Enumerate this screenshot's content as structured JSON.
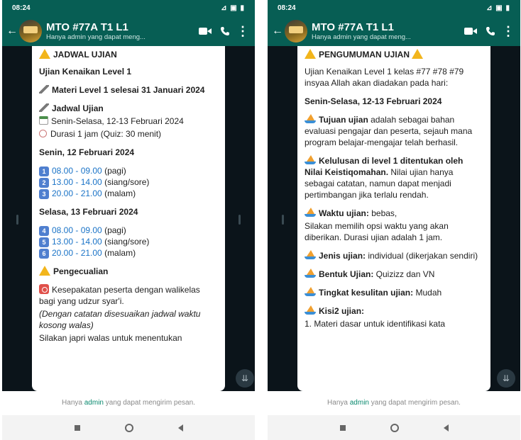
{
  "status_bar": {
    "time": "08:24",
    "icons": "⊿ ▣ ▮"
  },
  "chat_header": {
    "title": "MTO #77A T1 L1",
    "subtitle": "Hanya admin yang dapat meng...",
    "back_icon": "arrow-left-icon",
    "video_icon": "video-camera-icon",
    "call_icon": "phone-icon",
    "menu_icon": "kebab-menu-icon"
  },
  "left_message": {
    "heading": "JADWAL UJIAN",
    "exam_name": "Ujian Kenaikan Level 1",
    "materi": "Materi Level 1 selesai 31 Januari 2024",
    "jadwal_title": "Jadwal Ujian",
    "jadwal_date": "Senin-Selasa, 12-13 Februari 2024",
    "durasi": "Durasi 1 jam (Quiz: 30 menit)",
    "day1_title": "Senin, 12 Februari 2024",
    "day1_slots": [
      {
        "num": "1",
        "time": "08.00 - 09.00",
        "label": "(pagi)"
      },
      {
        "num": "2",
        "time": "13.00 - 14.00",
        "label": "(siang/sore)"
      },
      {
        "num": "3",
        "time": "20.00 - 21.00",
        "label": "(malam)"
      }
    ],
    "day2_title": "Selasa, 13 Februari 2024",
    "day2_slots": [
      {
        "num": "4",
        "time": "08.00 - 09.00",
        "label": "(pagi)"
      },
      {
        "num": "5",
        "time": "13.00 - 14.00",
        "label": "(siang/sore)"
      },
      {
        "num": "6",
        "time": "20.00 - 21.00",
        "label": "(malam)"
      }
    ],
    "exception_title": "Pengecualian",
    "exception_text": "Kesepakatan peserta dengan walikelas bagi yang udzur syar'i.",
    "exception_italic": "(Dengan catatan disesuaikan jadwal waktu kosong walas)",
    "cutoff_text": "Silakan japri walas untuk menentukan"
  },
  "right_message": {
    "heading": "PENGUMUMAN UJIAN",
    "intro": "Ujian Kenaikan Level 1 kelas #77 #78 #79 insyaa Allah akan diadakan pada hari:",
    "date": "Senin-Selasa, 12-13 Februari 2024",
    "tujuan_bold": "Tujuan ujian",
    "tujuan_text": " adalah sebagai bahan evaluasi pengajar dan peserta, sejauh mana program belajar-mengajar telah berhasil.",
    "kelulusan_bold": "Kelulusan di level 1 ditentukan oleh Nilai Keistiqomahan.",
    "kelulusan_text": " Nilai ujian hanya sebagai catatan, namun dapat menjadi pertimbangan jika terlalu rendah.",
    "waktu_bold": "Waktu ujian:",
    "waktu_text": " bebas,",
    "waktu_detail": "Silakan memilih opsi waktu yang akan diberikan. Durasi ujian adalah 1 jam.",
    "jenis_bold": "Jenis ujian:",
    "jenis_text": " individual (dikerjakan sendiri)",
    "bentuk_bold": "Bentuk Ujian:",
    "bentuk_text": " Quizizz dan VN",
    "tingkat_bold": "Tingkat kesulitan ujian:",
    "tingkat_text": " Mudah",
    "kisi_bold": "Kisi2 ujian:",
    "kisi_item": "1. Materi dasar untuk identifikasi kata"
  },
  "bottom_notice": {
    "prefix": "Hanya ",
    "admin": "admin",
    "suffix": " yang dapat mengirim pesan."
  },
  "scroll_button_icon": "double-chevron-down-icon",
  "nav_bar": {
    "recents_icon": "recents-icon",
    "home_icon": "home-icon",
    "back_icon": "back-triangle-icon"
  },
  "colors": {
    "header": "#075e54",
    "chat_bg": "#0b141a",
    "link": "#1a73c7",
    "admin": "#0b8a6f",
    "warning": "#f2b51c"
  }
}
